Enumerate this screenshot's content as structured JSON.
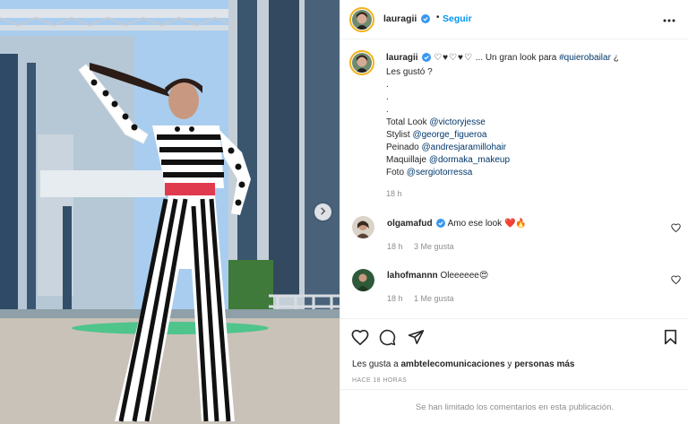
{
  "post": {
    "username": "lauragii",
    "follow_label": "Seguir",
    "separator": "•"
  },
  "caption": {
    "username": "lauragii",
    "hearts": "♡♥♡♥♡",
    "text_before_tag": "... Un gran look para ",
    "hashtag": "#quierobailar",
    "text_after_tag": " ¿",
    "line2": "Les gustó ?",
    "dots": [
      ".",
      ".",
      "."
    ],
    "credits": [
      {
        "label": "Total Look ",
        "handle": "@victoryjesse"
      },
      {
        "label": "Stylist ",
        "handle": "@george_figueroa"
      },
      {
        "label": "Peinado ",
        "handle": "@andresjaramillohair"
      },
      {
        "label": "Maquillaje ",
        "handle": "@dormaka_makeup"
      },
      {
        "label": "Foto ",
        "handle": "@sergiotorressa"
      }
    ],
    "time": "18 h"
  },
  "comments": [
    {
      "username": "olgamafud",
      "text": "Amo ese look ",
      "emoji": "❤️🔥",
      "time": "18 h",
      "likes": "3 Me gusta",
      "verified": true
    },
    {
      "username": "lahofmannn",
      "text": "Oleeeeee",
      "emoji": "😍",
      "time": "18 h",
      "likes": "1 Me gusta",
      "verified": false
    }
  ],
  "footer": {
    "likes_prefix": "Les gusta a ",
    "likes_user": "ambtelecomunicaciones",
    "likes_middle": " y ",
    "likes_others": "personas más",
    "ago": "HACE 18 HORAS",
    "limited": "Se han limitado los comentarios en esta publicación."
  },
  "icons": {
    "verified": "verified-badge-icon",
    "more": "more-options-icon",
    "like": "heart-icon",
    "comment": "comment-icon",
    "share": "share-icon",
    "save": "bookmark-icon",
    "next": "chevron-right-icon"
  },
  "colors": {
    "accent": "#0095f6",
    "link": "#00376b",
    "muted": "#8e8e8e",
    "verified": "#3897f0"
  }
}
